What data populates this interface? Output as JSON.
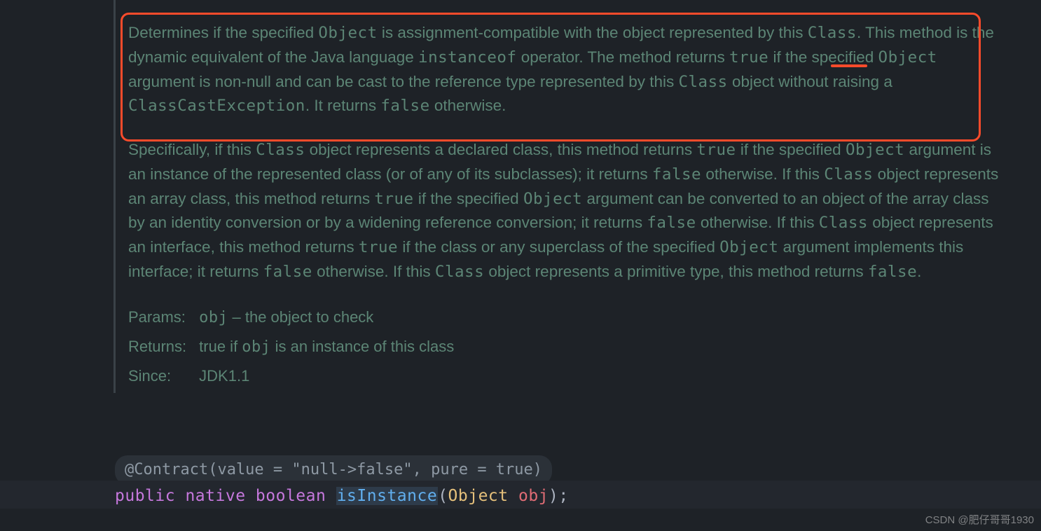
{
  "doc": {
    "p1_t1": "Determines if the specified ",
    "p1_c1": "Object",
    "p1_t2": " is assignment-compatible with the object represented by this ",
    "p1_c2": "Class",
    "p1_t3": ". This method is the dynamic equivalent of the Java language ",
    "p1_c3": "instanceof",
    "p1_t4": " operator. The method returns ",
    "p1_c4": "true",
    "p1_t5": " if the specified ",
    "p1_c5": "Object",
    "p1_t6": " argument is non-null and can be cast to the reference type represented by this ",
    "p1_c6": "Class",
    "p1_t7": " object without raising a ",
    "p1_c7": "ClassCastException",
    "p1_t8": ". It returns ",
    "p1_c8": "false",
    "p1_t9": " otherwise.",
    "p2_t1": "Specifically, if this ",
    "p2_c1": "Class",
    "p2_t2": " object represents a declared class, this method returns ",
    "p2_c2": "true",
    "p2_t3": " if the specified ",
    "p2_c3": "Object",
    "p2_t4": " argument is an instance of the represented class (or of any of its subclasses); it returns ",
    "p2_c4": "false",
    "p2_t5": " otherwise. If this ",
    "p2_c5": "Class",
    "p2_t6": " object represents an array class, this method returns ",
    "p2_c6": "true",
    "p2_t7": " if the specified ",
    "p2_c7": "Object",
    "p2_t8": " argument can be converted to an object of the array class by an identity conversion or by a widening reference conversion; it returns ",
    "p2_c8": "false",
    "p2_t9": " otherwise. If this ",
    "p2_c9": "Class",
    "p2_t10": " object represents an interface, this method returns ",
    "p2_c10": "true",
    "p2_t11": " if the class or any superclass of the specified ",
    "p2_c11": "Object",
    "p2_t12": " argument implements this interface; it returns ",
    "p2_c12": "false",
    "p2_t13": " otherwise. If this ",
    "p2_c13": "Class",
    "p2_t14": " object represents a primitive type, this method returns ",
    "p2_c14": "false",
    "p2_t15": "."
  },
  "tags": {
    "params_label": "Params:",
    "params_code": "obj",
    "params_text": " – the object to check",
    "returns_label": "Returns:",
    "returns_text1": "true if ",
    "returns_code": "obj",
    "returns_text2": " is an instance of this class",
    "since_label": "Since:",
    "since_value": "JDK1.1"
  },
  "gutter": {
    "at": "@"
  },
  "annotation": "@Contract(value = \"null->false\", pure = true)",
  "code": {
    "kw_public": "public",
    "kw_native": "native",
    "kw_boolean": "boolean",
    "method": "isInstance",
    "lparen": "(",
    "ptype": "Object",
    "pname": "obj",
    "rparen": ")",
    "semi": ";"
  },
  "watermark": "CSDN @肥仔哥哥1930"
}
